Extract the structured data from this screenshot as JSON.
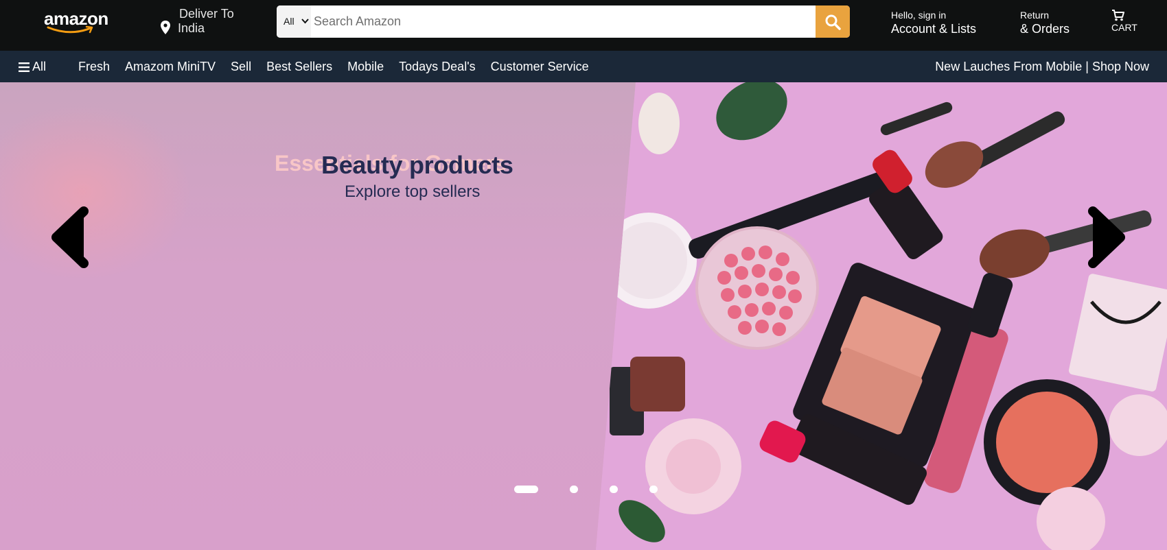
{
  "header": {
    "logo_text": "amazon",
    "deliver_line1": "Deliver To",
    "deliver_line2": "India",
    "search_category": "All",
    "search_placeholder": "Search Amazon",
    "account_small": "Hello, sign in",
    "account_big": "Account & Lists",
    "orders_small": "Return",
    "orders_big": "& Orders",
    "cart_label": "CART"
  },
  "nav": {
    "all_label": "All",
    "items": [
      "Fresh",
      "Amazom MiniTV",
      "Sell",
      "Best Sellers",
      "Mobile",
      "Todays Deal's",
      "Customer Service"
    ],
    "promo": "New Lauches From Mobile | Shop Now"
  },
  "hero": {
    "ghost_title": "Essentials for Gamers",
    "title": "Beauty products",
    "subtitle": "Explore top sellers",
    "slide_count": 4,
    "active_slide": 1
  },
  "colors": {
    "topbar": "#0f1111",
    "navbar": "#1b2838",
    "search_button": "#e9a33e",
    "hero_bg": "#d6a3c9",
    "title_text": "#252b52"
  },
  "icons": {
    "location": "location-pin-icon",
    "search": "search-icon",
    "cart": "cart-icon",
    "menu": "hamburger-icon",
    "prev": "chevron-left-icon",
    "next": "chevron-right-icon"
  }
}
